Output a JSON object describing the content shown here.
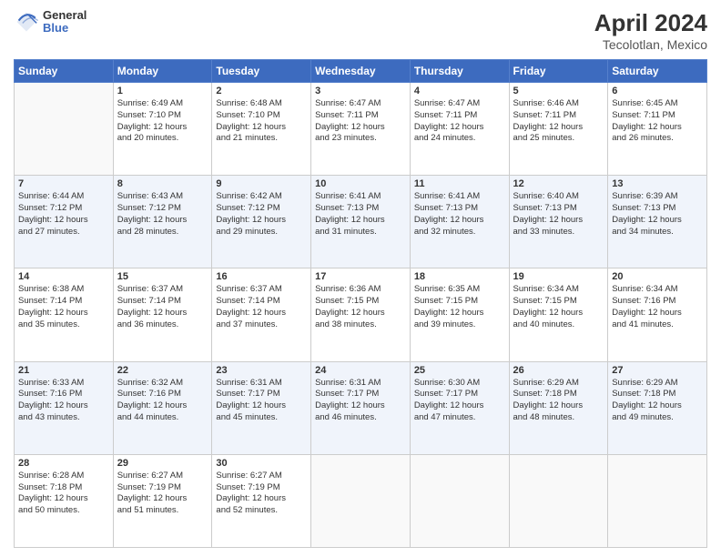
{
  "header": {
    "logo_line1": "General",
    "logo_line2": "Blue",
    "title": "April 2024",
    "subtitle": "Tecolotlan, Mexico"
  },
  "days_header": [
    "Sunday",
    "Monday",
    "Tuesday",
    "Wednesday",
    "Thursday",
    "Friday",
    "Saturday"
  ],
  "weeks": [
    [
      {
        "num": "",
        "info": ""
      },
      {
        "num": "1",
        "info": "Sunrise: 6:49 AM\nSunset: 7:10 PM\nDaylight: 12 hours\nand 20 minutes."
      },
      {
        "num": "2",
        "info": "Sunrise: 6:48 AM\nSunset: 7:10 PM\nDaylight: 12 hours\nand 21 minutes."
      },
      {
        "num": "3",
        "info": "Sunrise: 6:47 AM\nSunset: 7:11 PM\nDaylight: 12 hours\nand 23 minutes."
      },
      {
        "num": "4",
        "info": "Sunrise: 6:47 AM\nSunset: 7:11 PM\nDaylight: 12 hours\nand 24 minutes."
      },
      {
        "num": "5",
        "info": "Sunrise: 6:46 AM\nSunset: 7:11 PM\nDaylight: 12 hours\nand 25 minutes."
      },
      {
        "num": "6",
        "info": "Sunrise: 6:45 AM\nSunset: 7:11 PM\nDaylight: 12 hours\nand 26 minutes."
      }
    ],
    [
      {
        "num": "7",
        "info": "Sunrise: 6:44 AM\nSunset: 7:12 PM\nDaylight: 12 hours\nand 27 minutes."
      },
      {
        "num": "8",
        "info": "Sunrise: 6:43 AM\nSunset: 7:12 PM\nDaylight: 12 hours\nand 28 minutes."
      },
      {
        "num": "9",
        "info": "Sunrise: 6:42 AM\nSunset: 7:12 PM\nDaylight: 12 hours\nand 29 minutes."
      },
      {
        "num": "10",
        "info": "Sunrise: 6:41 AM\nSunset: 7:13 PM\nDaylight: 12 hours\nand 31 minutes."
      },
      {
        "num": "11",
        "info": "Sunrise: 6:41 AM\nSunset: 7:13 PM\nDaylight: 12 hours\nand 32 minutes."
      },
      {
        "num": "12",
        "info": "Sunrise: 6:40 AM\nSunset: 7:13 PM\nDaylight: 12 hours\nand 33 minutes."
      },
      {
        "num": "13",
        "info": "Sunrise: 6:39 AM\nSunset: 7:13 PM\nDaylight: 12 hours\nand 34 minutes."
      }
    ],
    [
      {
        "num": "14",
        "info": "Sunrise: 6:38 AM\nSunset: 7:14 PM\nDaylight: 12 hours\nand 35 minutes."
      },
      {
        "num": "15",
        "info": "Sunrise: 6:37 AM\nSunset: 7:14 PM\nDaylight: 12 hours\nand 36 minutes."
      },
      {
        "num": "16",
        "info": "Sunrise: 6:37 AM\nSunset: 7:14 PM\nDaylight: 12 hours\nand 37 minutes."
      },
      {
        "num": "17",
        "info": "Sunrise: 6:36 AM\nSunset: 7:15 PM\nDaylight: 12 hours\nand 38 minutes."
      },
      {
        "num": "18",
        "info": "Sunrise: 6:35 AM\nSunset: 7:15 PM\nDaylight: 12 hours\nand 39 minutes."
      },
      {
        "num": "19",
        "info": "Sunrise: 6:34 AM\nSunset: 7:15 PM\nDaylight: 12 hours\nand 40 minutes."
      },
      {
        "num": "20",
        "info": "Sunrise: 6:34 AM\nSunset: 7:16 PM\nDaylight: 12 hours\nand 41 minutes."
      }
    ],
    [
      {
        "num": "21",
        "info": "Sunrise: 6:33 AM\nSunset: 7:16 PM\nDaylight: 12 hours\nand 43 minutes."
      },
      {
        "num": "22",
        "info": "Sunrise: 6:32 AM\nSunset: 7:16 PM\nDaylight: 12 hours\nand 44 minutes."
      },
      {
        "num": "23",
        "info": "Sunrise: 6:31 AM\nSunset: 7:17 PM\nDaylight: 12 hours\nand 45 minutes."
      },
      {
        "num": "24",
        "info": "Sunrise: 6:31 AM\nSunset: 7:17 PM\nDaylight: 12 hours\nand 46 minutes."
      },
      {
        "num": "25",
        "info": "Sunrise: 6:30 AM\nSunset: 7:17 PM\nDaylight: 12 hours\nand 47 minutes."
      },
      {
        "num": "26",
        "info": "Sunrise: 6:29 AM\nSunset: 7:18 PM\nDaylight: 12 hours\nand 48 minutes."
      },
      {
        "num": "27",
        "info": "Sunrise: 6:29 AM\nSunset: 7:18 PM\nDaylight: 12 hours\nand 49 minutes."
      }
    ],
    [
      {
        "num": "28",
        "info": "Sunrise: 6:28 AM\nSunset: 7:18 PM\nDaylight: 12 hours\nand 50 minutes."
      },
      {
        "num": "29",
        "info": "Sunrise: 6:27 AM\nSunset: 7:19 PM\nDaylight: 12 hours\nand 51 minutes."
      },
      {
        "num": "30",
        "info": "Sunrise: 6:27 AM\nSunset: 7:19 PM\nDaylight: 12 hours\nand 52 minutes."
      },
      {
        "num": "",
        "info": ""
      },
      {
        "num": "",
        "info": ""
      },
      {
        "num": "",
        "info": ""
      },
      {
        "num": "",
        "info": ""
      }
    ]
  ]
}
